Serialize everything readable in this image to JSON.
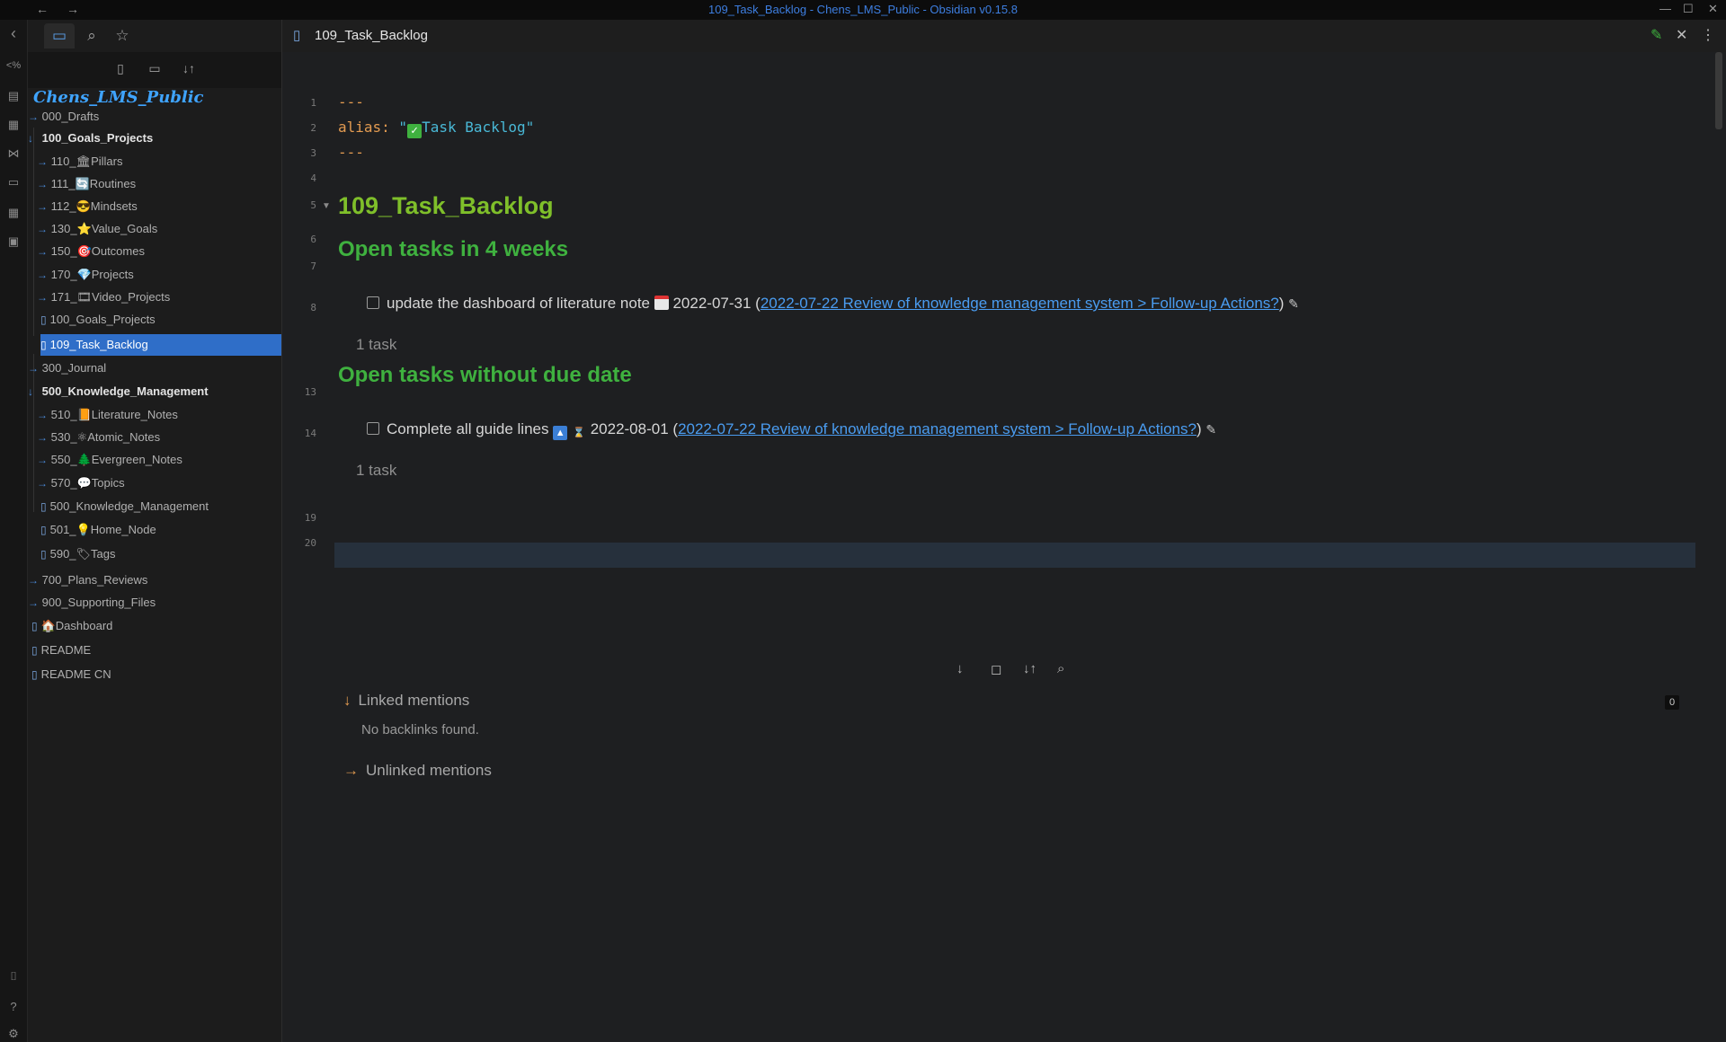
{
  "window": {
    "title": "109_Task_Backlog - Chens_LMS_Public - Obsidian v0.15.8",
    "back": "←",
    "forward": "→",
    "minimize": "—",
    "maximize": "☐",
    "close": "✕"
  },
  "ribbon": {
    "collapse": "‹",
    "icons": [
      "<%",
      "▤",
      "▦",
      "⋈",
      "▭",
      "▦",
      "▣",
      "⌷",
      "?",
      "⚙"
    ]
  },
  "sidebar": {
    "tabs": [
      "▭",
      "⌕",
      "☆"
    ],
    "actions": [
      "▯",
      "▭",
      "↓↑"
    ],
    "vault_name": "Chens_LMS_Public",
    "tree": [
      {
        "label": "000_Drafts",
        "type": "folder",
        "depth": 0,
        "open": false
      },
      {
        "label": "100_Goals_Projects",
        "type": "folder",
        "depth": 0,
        "open": true
      },
      {
        "label": "110_🏛Pillars",
        "type": "folder",
        "depth": 1,
        "open": false
      },
      {
        "label": "111_🔄Routines",
        "type": "folder",
        "depth": 1,
        "open": false
      },
      {
        "label": "112_😎Mindsets",
        "type": "folder",
        "depth": 1,
        "open": false
      },
      {
        "label": "130_⭐Value_Goals",
        "type": "folder",
        "depth": 1,
        "open": false
      },
      {
        "label": "150_🎯Outcomes",
        "type": "folder",
        "depth": 1,
        "open": false
      },
      {
        "label": "170_💎Projects",
        "type": "folder",
        "depth": 1,
        "open": false
      },
      {
        "label": "171_🎞Video_Projects",
        "type": "folder",
        "depth": 1,
        "open": false
      },
      {
        "label": "100_Goals_Projects",
        "type": "file",
        "depth": 1
      },
      {
        "label": "109_Task_Backlog",
        "type": "file",
        "depth": 1,
        "selected": true
      },
      {
        "label": "300_Journal",
        "type": "folder",
        "depth": 0,
        "open": false
      },
      {
        "label": "500_Knowledge_Management",
        "type": "folder",
        "depth": 0,
        "open": true
      },
      {
        "label": "510_📙Literature_Notes",
        "type": "folder",
        "depth": 1,
        "open": false
      },
      {
        "label": "530_⚛Atomic_Notes",
        "type": "folder",
        "depth": 1,
        "open": false
      },
      {
        "label": "550_🌲Evergreen_Notes",
        "type": "folder",
        "depth": 1,
        "open": false
      },
      {
        "label": "570_💬Topics",
        "type": "folder",
        "depth": 1,
        "open": false
      },
      {
        "label": "500_Knowledge_Management",
        "type": "file",
        "depth": 1
      },
      {
        "label": "501_💡Home_Node",
        "type": "file",
        "depth": 1
      },
      {
        "label": "590_🏷Tags",
        "type": "file",
        "depth": 1
      },
      {
        "label": "700_Plans_Reviews",
        "type": "folder",
        "depth": 0,
        "open": false
      },
      {
        "label": "900_Supporting_Files",
        "type": "folder",
        "depth": 0,
        "open": false
      },
      {
        "label": "🏠Dashboard",
        "type": "file",
        "depth": 0
      },
      {
        "label": "README",
        "type": "file",
        "depth": 0
      },
      {
        "label": "README CN",
        "type": "file",
        "depth": 0
      }
    ]
  },
  "tab": {
    "icon": "▯",
    "title": "109_Task_Backlog",
    "edit_icon": "✎",
    "close_icon": "✕",
    "more_icon": "⋮"
  },
  "editor": {
    "line_numbers": [
      "1",
      "2",
      "3",
      "4",
      "5",
      "6",
      "7",
      "8",
      "13",
      "14",
      "19",
      "20"
    ],
    "frontmatter_open": "---",
    "alias_key": "alias:",
    "alias_quote_open": " \"",
    "alias_emoji": "✓",
    "alias_value": "Task Backlog",
    "alias_quote_close": "\"",
    "frontmatter_close": "---",
    "heading1": "109_Task_Backlog",
    "section1": {
      "heading": "Open tasks in 4 weeks",
      "task_text": "update the dashboard of literature note",
      "task_date": "2022-07-31",
      "task_link": "2022-07-22 Review of knowledge management system > Follow-up Actions?",
      "count": "1 task"
    },
    "section2": {
      "heading": "Open tasks without due date",
      "task_text": "Complete all guide lines",
      "task_date": "2022-08-01",
      "task_link": "2022-07-22 Review of knowledge management system > Follow-up Actions?",
      "count": "1 task"
    }
  },
  "backlinks": {
    "toolbar": [
      "↓",
      "◻",
      "↓↑",
      "⌕"
    ],
    "linked_label": "Linked mentions",
    "linked_count": "0",
    "no_backlinks": "No backlinks found.",
    "unlinked_label": "Unlinked mentions"
  },
  "colors": {
    "accent": "#2f6ec8",
    "heading1": "#7fbf2a",
    "heading2": "#3fb13f",
    "link": "#4a9cf0",
    "frontmatter": "#e39b51"
  }
}
